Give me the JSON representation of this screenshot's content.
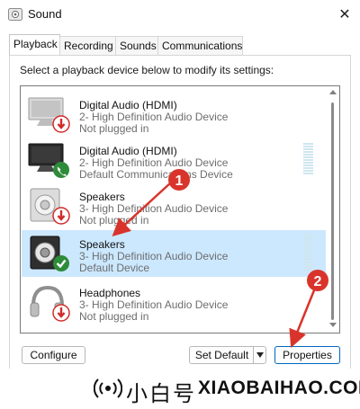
{
  "window": {
    "title": "Sound"
  },
  "tabs": [
    {
      "label": "Playback",
      "active": true
    },
    {
      "label": "Recording"
    },
    {
      "label": "Sounds"
    },
    {
      "label": "Communications"
    }
  ],
  "instruction": "Select a playback device below to modify its settings:",
  "devices": [
    {
      "name": "Digital Audio (HDMI)",
      "description": "2- High Definition Audio Device",
      "status": "Not plugged in",
      "icon": "monitor-icon",
      "badge": "unplugged-badge-icon"
    },
    {
      "name": "Digital Audio (HDMI)",
      "description": "2- High Definition Audio Device",
      "status": "Default Communications Device",
      "icon": "monitor-icon",
      "badge": "phone-badge-icon"
    },
    {
      "name": "Speakers",
      "description": "3- High Definition Audio Device",
      "status": "Not plugged in",
      "icon": "speaker-icon",
      "badge": "unplugged-badge-icon"
    },
    {
      "name": "Speakers",
      "description": "3- High Definition Audio Device",
      "status": "Default Device",
      "icon": "speaker-icon",
      "badge": "default-check-badge-icon",
      "selected": true
    },
    {
      "name": "Headphones",
      "description": "3- High Definition Audio Device",
      "status": "Not plugged in",
      "icon": "headphones-icon",
      "badge": "unplugged-badge-icon"
    }
  ],
  "buttons": {
    "configure": "Configure",
    "set_default": "Set Default",
    "properties": "Properties"
  },
  "annotations": {
    "one": "1",
    "two": "2"
  },
  "watermark": {
    "cn": "小白号",
    "en": "XIAOBAIHAO.COM"
  },
  "colors": {
    "selection": "#cce8ff",
    "annotation_red": "#d9342b",
    "badge_red": "#d12b2b",
    "badge_green": "#2e8b3a"
  }
}
